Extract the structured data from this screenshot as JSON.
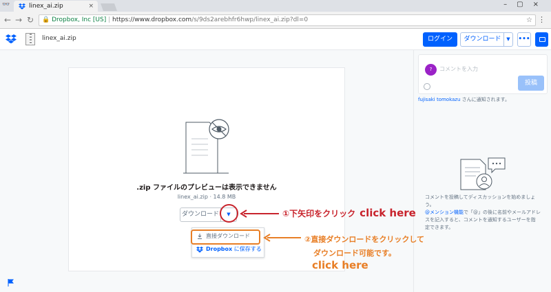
{
  "browser": {
    "tab_title": "linex_ai.zip",
    "tab_close": "×",
    "site_identity": "Dropbox, Inc [US]",
    "url_host": "https://www.dropbox.com",
    "url_path": "/s/9ds2arebhfr6hwp/linex_ai.zip?dl=0",
    "window_controls": "–▢×"
  },
  "header": {
    "file_name": "linex_ai.zip",
    "login_label": "ログイン",
    "download_label": "ダウンロード",
    "more_label": "•••"
  },
  "preview": {
    "title": ".zip ファイルのプレビューは表示できません",
    "meta": "linex_ai.zip · 14.8 MB",
    "download_label": "ダウンロード",
    "menu": {
      "direct_download": "直接ダウンロード",
      "save_to_dropbox_prefix": "Dropbox",
      "save_to_dropbox_suffix": " に保存する"
    }
  },
  "sidebar": {
    "avatar_initial": "?",
    "comment_placeholder": "コメントを入力",
    "post_label": "投稿",
    "notify_user": "fujisaki tomokazu",
    "notify_suffix": " さんに通知されます。",
    "info_line1": "コメントを投稿してディスカッションを始めましょう。",
    "info_mention": "@メンション機能",
    "info_line2a": "で「@」の後に名前やメールアドレ",
    "info_line3": "スを記入すると、コメントを通知するユーザーを指",
    "info_line4": "定できます。"
  },
  "annotations": {
    "step1": "①下矢印をクリック",
    "step1_en": "click here",
    "step2_line1": "②直接ダウンロードをクリックして",
    "step2_line2": "ダウンロード可能です。",
    "step2_en": "click here",
    "red_color": "#c8232c",
    "orange_color": "#e87e25"
  },
  "colors": {
    "brand_blue": "#0061fe",
    "avatar_purple": "#9b22c7"
  }
}
